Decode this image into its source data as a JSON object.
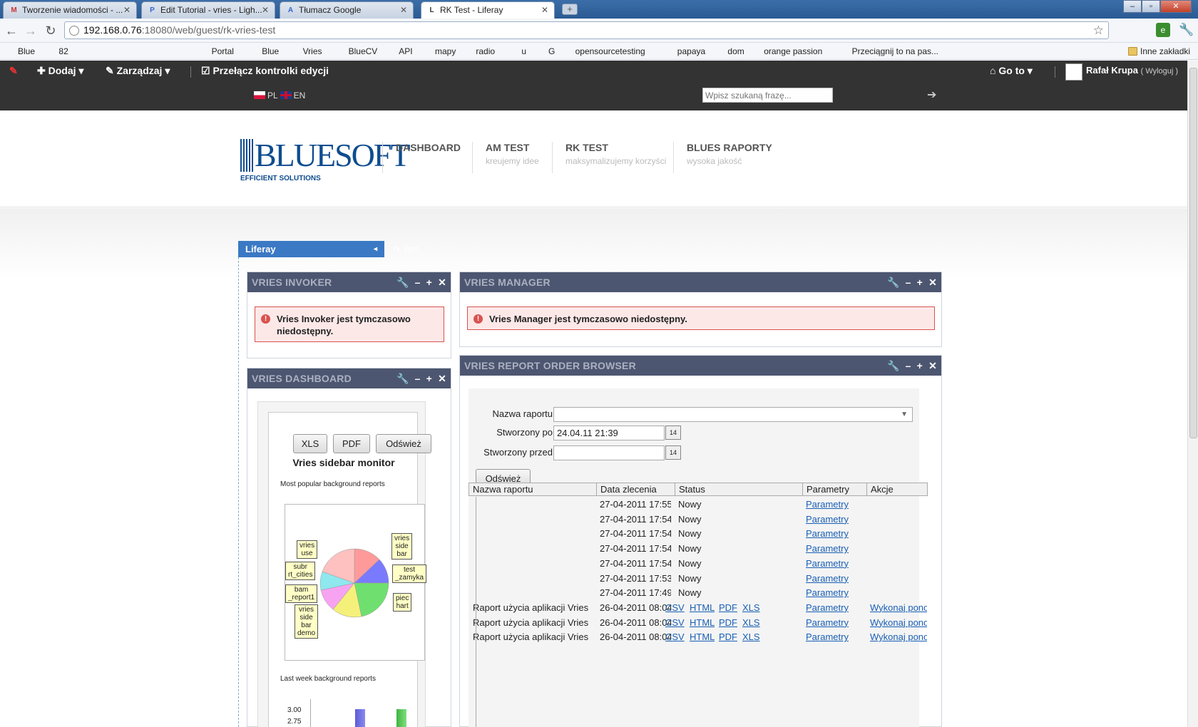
{
  "browser": {
    "tabs": [
      {
        "title": "Tworzenie wiadomości - ...",
        "icon": "M"
      },
      {
        "title": "Edit Tutorial - vries - Ligh...",
        "icon": "P"
      },
      {
        "title": "Tłumacz Google",
        "icon": "A"
      },
      {
        "title": "RK Test - Liferay",
        "icon": "L"
      }
    ],
    "url_host": "192.168.0.76",
    "url_path": ":18080/web/guest/rk-vries-test",
    "bookmarks": [
      {
        "label": "Blue",
        "type": "gmail"
      },
      {
        "label": "82",
        "type": "gmail"
      },
      {
        "label": "",
        "type": "icon"
      },
      {
        "label": "",
        "type": "icon"
      },
      {
        "label": "",
        "type": "icon"
      },
      {
        "label": "",
        "type": "icon"
      },
      {
        "label": "",
        "type": "icon"
      },
      {
        "label": "",
        "type": "icon"
      },
      {
        "label": "",
        "type": "icon"
      },
      {
        "label": "",
        "type": "icon"
      },
      {
        "label": "",
        "type": "icon"
      },
      {
        "label": "",
        "type": "icon"
      },
      {
        "label": "Portal",
        "type": "folder"
      },
      {
        "label": "Blue",
        "type": "folder"
      },
      {
        "label": "Vries",
        "type": "folder"
      },
      {
        "label": "BlueCV",
        "type": "folder"
      },
      {
        "label": "API",
        "type": "folder"
      },
      {
        "label": "mapy",
        "type": "folder"
      },
      {
        "label": "radio",
        "type": "folder"
      },
      {
        "label": "u",
        "type": "folder"
      },
      {
        "label": "G",
        "type": "folder"
      },
      {
        "label": "opensourcetesting",
        "type": "page"
      },
      {
        "label": "papaya",
        "type": "page"
      },
      {
        "label": "dom",
        "type": "page"
      },
      {
        "label": "orange passion",
        "type": "page"
      },
      {
        "label": "Przeciągnij to na pas...",
        "type": "page"
      }
    ],
    "other_bookmarks": "Inne zakładki"
  },
  "dock": {
    "add": "Dodaj",
    "manage": "Zarządzaj",
    "toggle_edit": "Przełącz kontrolki edycji",
    "goto": "Go to",
    "user": "Rafał Krupa",
    "logout": "( Wyloguj )",
    "lang_pl": "PL",
    "lang_en": "EN",
    "search_placeholder": "Wpisz szukaną frazę..."
  },
  "header": {
    "logo": "BLUESOFT",
    "logo_tagline": "EFFICIENT SOLUTIONS",
    "nav": [
      {
        "title": "DASHBOARD",
        "sub": ""
      },
      {
        "title": "AM TEST",
        "sub": "kreujemy idee"
      },
      {
        "title": "RK TEST",
        "sub": "maksymalizujemy korzyści"
      },
      {
        "title": "BLUES RAPORTY",
        "sub": "wysoka jakość"
      }
    ]
  },
  "liferay_menu": {
    "label": "Liferay",
    "ghost": "rk Test"
  },
  "portlets": {
    "invoker": {
      "title": "VRIES INVOKER",
      "error": "Vries Invoker jest tymczasowo niedostępny."
    },
    "manager": {
      "title": "VRIES MANAGER",
      "error": "Vries Manager jest tymczasowo niedostępny."
    },
    "dashboard": {
      "title": "VRIES DASHBOARD",
      "buttons": {
        "xls": "XLS",
        "pdf": "PDF",
        "refresh": "Odśwież"
      },
      "monitor_title": "Vries sidebar monitor",
      "popular_title": "Most popular background reports",
      "lastweek_title": "Last week background reports",
      "pie_labels": [
        "vries\nuse",
        "vries\nside\nbar",
        "subr\nrt_cities",
        "test\n_zamyka",
        "bam\n_report1",
        "piec\nhart",
        "vries\nside\nbar\ndemo"
      ],
      "y_ticks": [
        "3.00",
        "2.75"
      ]
    },
    "report_browser": {
      "title": "VRIES REPORT ORDER BROWSER",
      "report_name_label": "Nazwa raportu",
      "created_after_label": "Stworzony po",
      "created_after_value": "24.04.11 21:39",
      "created_before_label": "Stworzony przed",
      "refresh_button": "Odśwież",
      "columns": [
        "Nazwa raportu",
        "Data zlecenia",
        "Status",
        "Parametry",
        "Akcje"
      ],
      "rows": [
        {
          "name": "",
          "date": "27-04-2011 17:55",
          "status": "Nowy",
          "formats": [],
          "params": "Parametry",
          "action": ""
        },
        {
          "name": "",
          "date": "27-04-2011 17:54",
          "status": "Nowy",
          "formats": [],
          "params": "Parametry",
          "action": ""
        },
        {
          "name": "",
          "date": "27-04-2011 17:54",
          "status": "Nowy",
          "formats": [],
          "params": "Parametry",
          "action": ""
        },
        {
          "name": "",
          "date": "27-04-2011 17:54",
          "status": "Nowy",
          "formats": [],
          "params": "Parametry",
          "action": ""
        },
        {
          "name": "",
          "date": "27-04-2011 17:54",
          "status": "Nowy",
          "formats": [],
          "params": "Parametry",
          "action": ""
        },
        {
          "name": "",
          "date": "27-04-2011 17:53",
          "status": "Nowy",
          "formats": [],
          "params": "Parametry",
          "action": ""
        },
        {
          "name": "",
          "date": "27-04-2011 17:49",
          "status": "Nowy",
          "formats": [],
          "params": "Parametry",
          "action": ""
        },
        {
          "name": "Raport użycia aplikacji Vries",
          "date": "26-04-2011 08:04",
          "status": "",
          "formats": [
            "CSV",
            "HTML",
            "PDF",
            "XLS"
          ],
          "params": "Parametry",
          "action": "Wykonaj ponownie"
        },
        {
          "name": "Raport użycia aplikacji Vries",
          "date": "26-04-2011 08:04",
          "status": "",
          "formats": [
            "CSV",
            "HTML",
            "PDF",
            "XLS"
          ],
          "params": "Parametry",
          "action": "Wykonaj ponownie"
        },
        {
          "name": "Raport użycia aplikacji Vries",
          "date": "26-04-2011 08:04",
          "status": "",
          "formats": [
            "CSV",
            "HTML",
            "PDF",
            "XLS"
          ],
          "params": "Parametry",
          "action": "Wykonaj ponownie"
        }
      ]
    }
  }
}
